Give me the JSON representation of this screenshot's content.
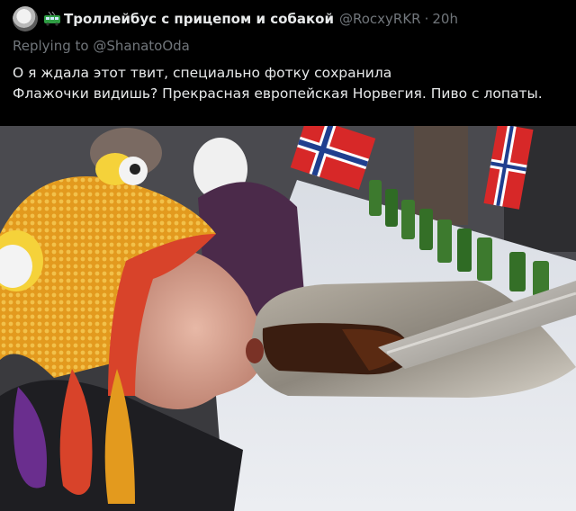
{
  "author": {
    "display_name": "Троллейбус с прицепом и собакой",
    "handle": "@RocxyRKR",
    "separator": "·",
    "time": "20h"
  },
  "reply": {
    "prefix": "Replying to",
    "handle": "@ShanatoOda"
  },
  "body": {
    "lines": [
      "О я ждала этот твит, специально фотку сохранила",
      "Флажочки видишь? Прекрасная европейская Норвегия. Пиво с лопаты."
    ]
  },
  "icons": {
    "avatar": "avatar-photo",
    "name_emoji": "trolleybus-icon"
  },
  "colors": {
    "background": "#000000",
    "text_primary": "#e7e9ea",
    "text_secondary": "#71767b"
  }
}
